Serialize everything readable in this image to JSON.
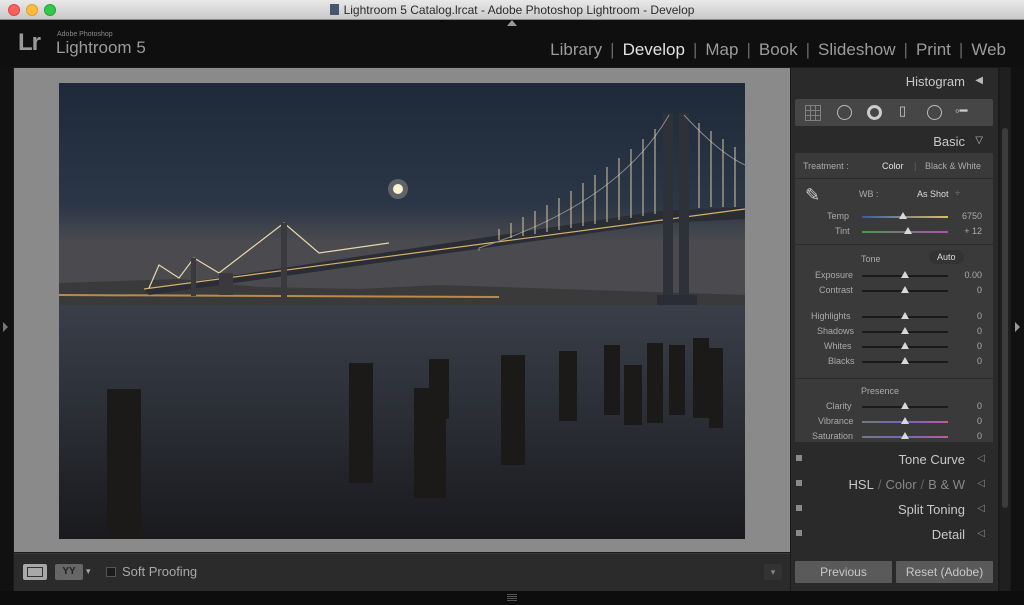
{
  "window": {
    "title": "Lightroom 5 Catalog.lrcat - Adobe Photoshop Lightroom - Develop"
  },
  "brand": {
    "badge": "Lr",
    "vendor": "Adobe Photoshop",
    "product": "Lightroom 5"
  },
  "modules": [
    {
      "label": "Library"
    },
    {
      "label": "Develop",
      "active": true
    },
    {
      "label": "Map"
    },
    {
      "label": "Book"
    },
    {
      "label": "Slideshow"
    },
    {
      "label": "Print"
    },
    {
      "label": "Web"
    }
  ],
  "toolbar": {
    "yy_label": "YY",
    "soft_proofing": "Soft Proofing"
  },
  "panels": {
    "histogram": "Histogram",
    "basic": "Basic",
    "tone_curve": "Tone Curve",
    "hsl": {
      "hsl": "HSL",
      "sep": "/",
      "color": "Color",
      "bw": "B & W"
    },
    "split_toning": "Split Toning",
    "detail": "Detail"
  },
  "basic": {
    "treatment_label": "Treatment :",
    "treatment_color": "Color",
    "treatment_bw": "Black & White",
    "wb_label": "WB :",
    "wb_value": "As Shot",
    "tone_label": "Tone",
    "auto_label": "Auto",
    "presence_label": "Presence",
    "sliders": {
      "temp": {
        "label": "Temp",
        "value": "6750",
        "position": 0.48
      },
      "tint": {
        "label": "Tint",
        "value": "+ 12",
        "position": 0.54
      },
      "exposure": {
        "label": "Exposure",
        "value": "0.00",
        "position": 0.5
      },
      "contrast": {
        "label": "Contrast",
        "value": "0",
        "position": 0.5
      },
      "highlights": {
        "label": "Highlights",
        "value": "0",
        "position": 0.5
      },
      "shadows": {
        "label": "Shadows",
        "value": "0",
        "position": 0.5
      },
      "whites": {
        "label": "Whites",
        "value": "0",
        "position": 0.5
      },
      "blacks": {
        "label": "Blacks",
        "value": "0",
        "position": 0.5
      },
      "clarity": {
        "label": "Clarity",
        "value": "0",
        "position": 0.5
      },
      "vibrance": {
        "label": "Vibrance",
        "value": "0",
        "position": 0.5
      },
      "saturation": {
        "label": "Saturation",
        "value": "0",
        "position": 0.5
      }
    }
  },
  "buttons": {
    "previous": "Previous",
    "reset": "Reset (Adobe)"
  },
  "colors": {
    "panel_bg": "#2a2a2a",
    "section_bg": "#3a3a3a",
    "canvas_bg": "#8a8a8a",
    "active_module": "#e2e2e2"
  }
}
